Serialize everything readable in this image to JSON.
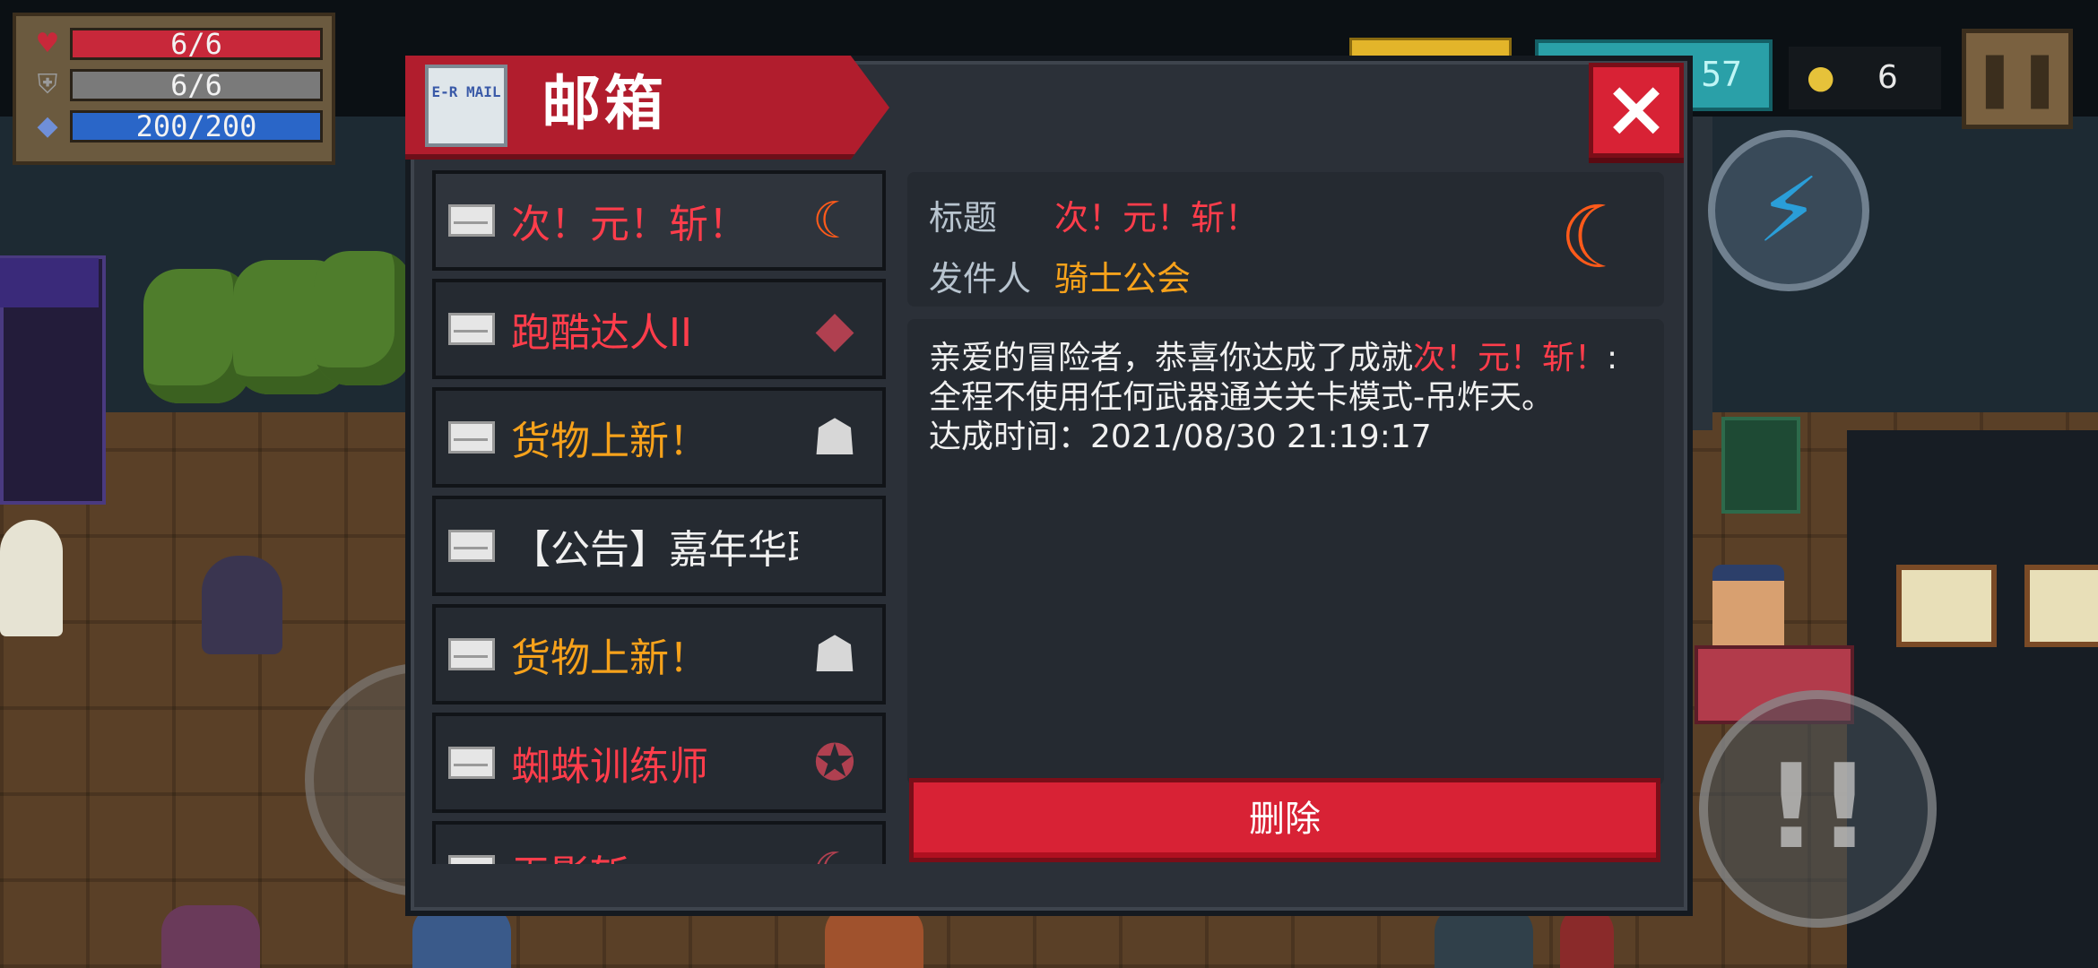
{
  "hud": {
    "hp": "6/6",
    "hp_fraction": 1.0,
    "armor": "6/6",
    "armor_fraction": 1.0,
    "energy": "200/200",
    "energy_fraction": 1.0,
    "gem_count_partial": "57",
    "coins": "6",
    "icons": [
      "heart-icon",
      "shield-icon",
      "diamond-icon",
      "coin-icon",
      "pause-icon",
      "lightning-icon",
      "attack-icon"
    ],
    "colors": {
      "hp": "#c8283a",
      "armor": "#7a7a7a",
      "energy": "#2a66c8"
    }
  },
  "mailbox": {
    "title": "邮箱",
    "envelope_text": "E-R MAIL",
    "close_label": "×",
    "items": [
      {
        "label": "次！元！斩！",
        "color": "red",
        "thumb_icon": "crescent-blade-icon",
        "thumb": "☾"
      },
      {
        "label": "跑酷达人II",
        "color": "red",
        "thumb_icon": "ninja-icon",
        "thumb": "◆"
      },
      {
        "label": "货物上新！",
        "color": "orange",
        "thumb_icon": "merchant-icon",
        "thumb": "☗"
      },
      {
        "label": "【公告】嘉年华联动",
        "color": "white",
        "thumb_icon": "",
        "thumb": ""
      },
      {
        "label": "货物上新！",
        "color": "orange",
        "thumb_icon": "merchant-icon",
        "thumb": "☗"
      },
      {
        "label": "蜘蛛训练师",
        "color": "red",
        "thumb_icon": "spider-trainer-icon",
        "thumb": "✪"
      },
      {
        "label": "无影斩",
        "color": "red",
        "thumb_icon": "blade-icon",
        "thumb": "☾"
      }
    ],
    "detail": {
      "title_label": "标题",
      "title_value": "次！元！斩！",
      "sender_label": "发件人",
      "sender_value": "骑士公会",
      "body_intro": "亲爱的冒险者，恭喜你达成了成就",
      "body_achievement": "次！元！斩！",
      "body_rest": ":全程不使用任何武器通关关卡模式-吊炸天。",
      "achieved_label": "达成时间：",
      "achieved_time": "2021/08/30 21:19:17"
    },
    "delete_label": "删除"
  }
}
